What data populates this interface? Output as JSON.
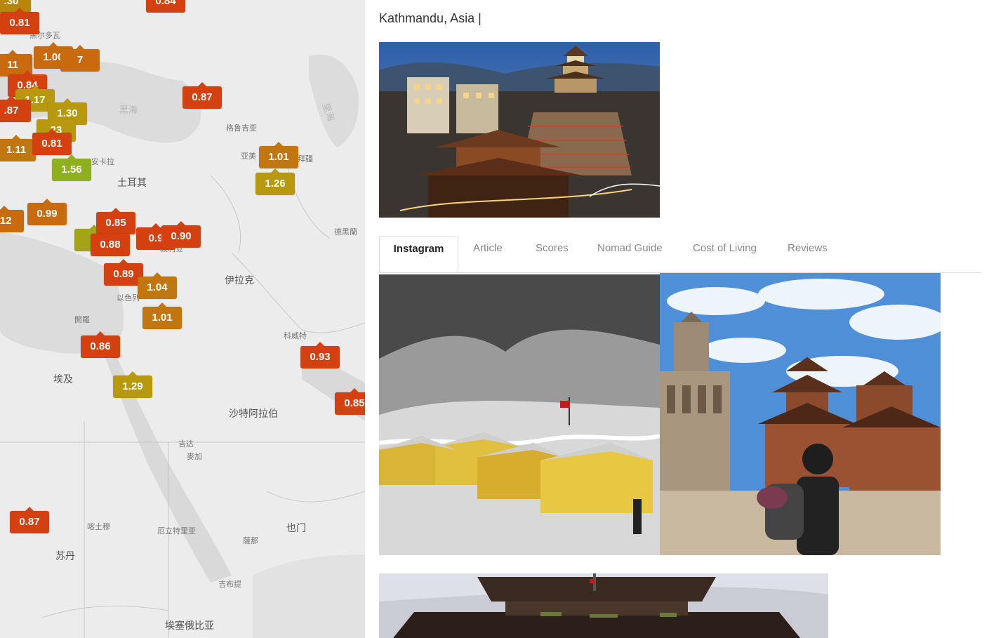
{
  "city": {
    "title": "Kathmandu, Asia |"
  },
  "tabs": [
    {
      "label": "Instagram",
      "active": true
    },
    {
      "label": "Article"
    },
    {
      "label": "Scores"
    },
    {
      "label": "Nomad Guide"
    },
    {
      "label": "Cost of Living"
    },
    {
      "label": "Reviews"
    }
  ],
  "map": {
    "labels": {
      "montenegro": "黑尔多瓦",
      "black_sea": "黑海",
      "caspian_sea": "里海",
      "georgia": "格鲁吉亚",
      "armenia": "亚美",
      "azerbaijan": "拜疆",
      "ankara": "安卡拉",
      "turkey": "土耳其",
      "tehran": "德黑蘭",
      "syria": "敘利亚",
      "iraq": "伊拉克",
      "israel": "以色列",
      "cairo": "開羅",
      "kuwait": "科威特",
      "egypt": "埃及",
      "saudi_arabia": "沙特阿拉伯",
      "jeddah": "吉达",
      "mecca": "麥加",
      "khartoum": "喀土穆",
      "eritrea": "厄立特里亚",
      "yemen": "也门",
      "sudan": "苏丹",
      "sanaa": "薩那",
      "djibouti": "吉布提",
      "ethiopia": "埃塞俄比亚"
    },
    "markers": [
      {
        "value": ".30",
        "color": "#b8860b"
      },
      {
        "value": "0.84",
        "color": "#d4400f"
      },
      {
        "value": "0.81",
        "color": "#d4400f"
      },
      {
        "value": "1.00",
        "color": "#c96a0f"
      },
      {
        "value": "7",
        "color": "#c96a0f"
      },
      {
        "value": "11",
        "color": "#c96a0f"
      },
      {
        "value": "0.84",
        "color": "#d4400f"
      },
      {
        "value": "1.17",
        "color": "#b8980c"
      },
      {
        "value": ".87",
        "color": "#d4400f"
      },
      {
        "value": "1.30",
        "color": "#b8980c"
      },
      {
        "value": "23",
        "color": "#b8980c"
      },
      {
        "value": "1.11",
        "color": "#c2760f"
      },
      {
        "value": "0.81",
        "color": "#d4400f"
      },
      {
        "value": "1.56",
        "color": "#8fb01e"
      },
      {
        "value": "0.87",
        "color": "#d4400f"
      },
      {
        "value": "1.01",
        "color": "#c2760f"
      },
      {
        "value": "1.26",
        "color": "#b8980c"
      },
      {
        "value": ".12",
        "color": "#c96a0f"
      },
      {
        "value": "0.99",
        "color": "#c96a0f"
      },
      {
        "value": "1",
        "color": "#a4a418"
      },
      {
        "value": "0.85",
        "color": "#d4400f"
      },
      {
        "value": "0.88",
        "color": "#d4400f"
      },
      {
        "value": "0.9",
        "color": "#d4400f"
      },
      {
        "value": "0.90",
        "color": "#d4400f"
      },
      {
        "value": "0.89",
        "color": "#d4400f"
      },
      {
        "value": "1.04",
        "color": "#c2760f"
      },
      {
        "value": "1.01",
        "color": "#c2760f"
      },
      {
        "value": "0.86",
        "color": "#d4400f"
      },
      {
        "value": "0.93",
        "color": "#d4400f"
      },
      {
        "value": "1.29",
        "color": "#b8980c"
      },
      {
        "value": "0.85",
        "color": "#d4400f"
      },
      {
        "value": "0.87",
        "color": "#d4400f"
      }
    ]
  }
}
